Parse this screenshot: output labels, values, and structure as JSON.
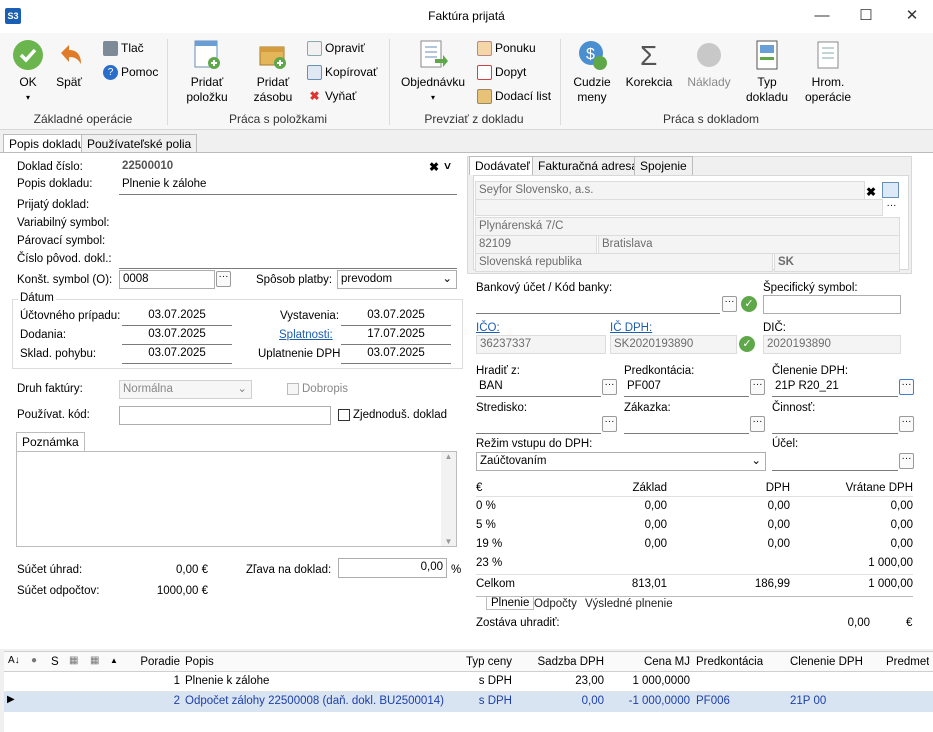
{
  "window": {
    "app_logo": "S3",
    "title": "Faktúra prijatá"
  },
  "ribbon": {
    "ok": "OK",
    "back": "Späť",
    "print": "Tlač",
    "help": "Pomoc",
    "group_basic": "Základné operácie",
    "add_item": "Pridať položku",
    "add_stock": "Pridať zásobu",
    "edit": "Opraviť",
    "copy": "Kopírovať",
    "cut": "Vyňať",
    "group_items": "Práca s položkami",
    "order": "Objednávku",
    "offer": "Ponuku",
    "demand": "Dopyt",
    "delivery_list": "Dodací list",
    "group_take": "Prevziať z dokladu",
    "foreign_currency": "Cudzie meny",
    "correction": "Korekcia",
    "costs": "Náklady",
    "doc_type": "Typ dokladu",
    "bulk_ops": "Hrom. operácie",
    "group_doc": "Práca s dokladom"
  },
  "tabs": [
    "Popis dokladu",
    "Používateľské polia"
  ],
  "form": {
    "doc_no_label": "Doklad číslo:",
    "doc_no": "22500010",
    "desc_label": "Popis dokladu:",
    "desc": "Plnenie k zálohe",
    "received_label": "Prijatý doklad:",
    "var_symbol_label": "Variabilný symbol:",
    "pair_symbol_label": "Párovací symbol:",
    "orig_doc_label": "Číslo pôvod. dokl.:",
    "const_symbol_label": "Konšt. symbol (O):",
    "const_symbol": "0008",
    "payment_label": "Spôsob platby:",
    "payment": "prevodom",
    "dates_title": "Dátum",
    "acc_case_label": "Účtovného prípadu:",
    "acc_case": "03.07.2025",
    "issue_label": "Vystavenia:",
    "issue": "03.07.2025",
    "delivery_label": "Dodania:",
    "delivery": "03.07.2025",
    "due_label": "Splatnosti:",
    "due": "17.07.2025",
    "stock_label": "Sklad. pohybu:",
    "stock": "03.07.2025",
    "vat_apply_label": "Uplatnenie DPH:",
    "vat_apply": "03.07.2025",
    "invoice_type_label": "Druh faktúry:",
    "invoice_type": "Normálna",
    "credit_note": "Dobropis",
    "user_code_label": "Používat. kód:",
    "simplified": "Zjednoduš. doklad",
    "note_tab": "Poznámka",
    "sum_paid_label": "Súčet úhrad:",
    "sum_paid": "0,00 €",
    "discount_label": "Zľava na doklad:",
    "discount": "0,00",
    "discount_unit": "%",
    "sum_deduct_label": "Súčet odpočtov:",
    "sum_deduct": "1000,00 €"
  },
  "supplier": {
    "tabs": [
      "Dodávateľ",
      "Fakturačná adresa",
      "Spojenie"
    ],
    "name": "Seyfor Slovensko, a.s.",
    "street": "Plynárenská 7/C",
    "zip": "82109",
    "city": "Bratislava",
    "country": "Slovenská republika",
    "country_code": "SK",
    "bank_label": "Bankový účet / Kód banky:",
    "spec_symbol_label": "Špecifický symbol:",
    "ico_label": "IČO:",
    "ico": "36237337",
    "icdph_label": "IČ DPH:",
    "icdph": "SK2020193890",
    "dic_label": "DIČ:",
    "dic": "2020193890",
    "pay_by_label": "Hradiť z:",
    "pay_by": "BAN",
    "precont_label": "Predkontácia:",
    "precont": "PF007",
    "vat_split_label": "Členenie DPH:",
    "vat_split": "21P R20_21",
    "center_label": "Stredisko:",
    "order_label": "Zákazka:",
    "activity_label": "Činnosť:",
    "vat_mode_label": "Režim vstupu do DPH:",
    "vat_mode": "Zaúčtovaním",
    "purpose_label": "Účel:"
  },
  "vat_table": {
    "headers": [
      "€",
      "Základ",
      "DPH",
      "Vrátane DPH"
    ],
    "rows": [
      [
        "0 %",
        "0,00",
        "0,00",
        "0,00"
      ],
      [
        "5 %",
        "0,00",
        "0,00",
        "0,00"
      ],
      [
        "19 %",
        "0,00",
        "0,00",
        "0,00"
      ],
      [
        "23 %",
        "",
        "",
        "1 000,00"
      ]
    ],
    "total": [
      "Celkom",
      "813,01",
      "186,99",
      "1 000,00"
    ],
    "subtabs": [
      "Plnenie",
      "Odpočty",
      "Výsledné plnenie"
    ],
    "remaining_label": "Zostáva uhradiť:",
    "remaining": "0,00",
    "currency": "€"
  },
  "items": {
    "headers": [
      "S",
      "Poradie",
      "Popis",
      "Typ ceny",
      "Sadzba DPH",
      "Cena MJ",
      "Predkontácia",
      "Členenie DPH",
      "Predmet"
    ],
    "rows": [
      {
        "no": "1",
        "desc": "Plnenie k zálohe",
        "price_type": "s DPH",
        "rate": "23,00",
        "price": "1 000,0000",
        "precont": "",
        "split": ""
      },
      {
        "no": "2",
        "desc": "Odpočet zálohy 22500008 (daň. dokl. BU2500014)",
        "price_type": "s DPH",
        "rate": "0,00",
        "price": "-1 000,0000",
        "precont": "PF006",
        "split": "21P 00"
      }
    ]
  }
}
